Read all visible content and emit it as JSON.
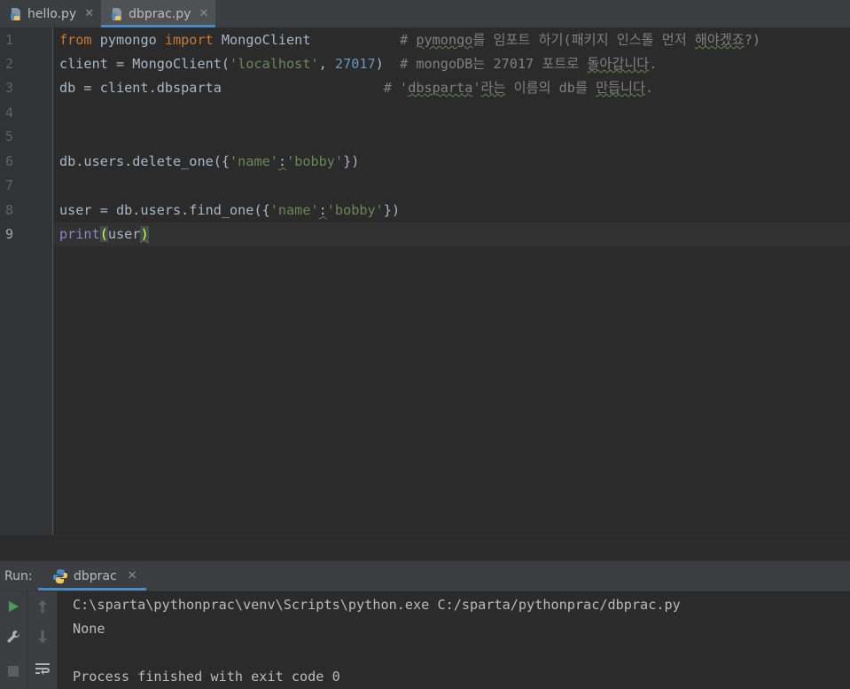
{
  "tabs": [
    {
      "label": "hello.py",
      "close": "✕",
      "active": false
    },
    {
      "label": "dbprac.py",
      "close": "✕",
      "active": true
    }
  ],
  "editor": {
    "line_numbers": [
      "1",
      "2",
      "3",
      "4",
      "5",
      "6",
      "7",
      "8",
      "9"
    ],
    "current_line": 9,
    "lines": {
      "l1": {
        "from": "from",
        "module": " pymongo ",
        "import": "import",
        "cls": " MongoClient",
        "pad": "           ",
        "comment_hash": "# ",
        "comment_word": "pymongo",
        "comment_rest": "를 임포트 하기(패키지 인스톨 먼저 ",
        "comment_word2": "해야겠죠",
        "comment_end": "?)"
      },
      "l2": {
        "a": "client = MongoClient(",
        "s": "'localhost'",
        "b": ", ",
        "n": "27017",
        "c": ")  ",
        "comment": "# mongoDB는 27017 포트로 ",
        "comment_word": "돌아갑니다",
        "comment_end": "."
      },
      "l3": {
        "a": "db = client.dbsparta",
        "pad": "                    ",
        "comment_hash": "# '",
        "comment_word": "dbsparta",
        "comment_mid": "'",
        "comment_word2": "라는",
        "comment_rest": " 이름의 db를 ",
        "comment_word3": "만듭니다",
        "comment_end": "."
      },
      "l6": {
        "a": "db.users.delete_one({",
        "s1": "'name'",
        "colon": ":",
        "s2": "'bobby'",
        "b": "})"
      },
      "l8": {
        "a": "user = db.users.find_one({",
        "s1": "'name'",
        "colon": ":",
        "s2": "'bobby'",
        "b": "})"
      },
      "l9": {
        "fn": "print",
        "open": "(",
        "arg": "user",
        "close": ")"
      }
    }
  },
  "run": {
    "label": "Run:",
    "tab_label": "dbprac",
    "tab_close": "✕",
    "output": [
      "C:\\sparta\\pythonprac\\venv\\Scripts\\python.exe C:/sparta/pythonprac/dbprac.py",
      "None",
      "",
      "Process finished with exit code 0"
    ]
  },
  "icons": {
    "file_tab": "python-file-icon",
    "run": "play-icon",
    "settings": "wrench-icon",
    "stop": "stop-icon",
    "up": "arrow-up-icon",
    "down": "arrow-down-icon",
    "wrap": "soft-wrap-icon"
  },
  "colors": {
    "keyword": "#cc7832",
    "string": "#6a8759",
    "number": "#6897bb",
    "comment": "#808080",
    "builtin": "#8888c6",
    "accent": "#4a88c7",
    "run_green": "#499c54"
  }
}
